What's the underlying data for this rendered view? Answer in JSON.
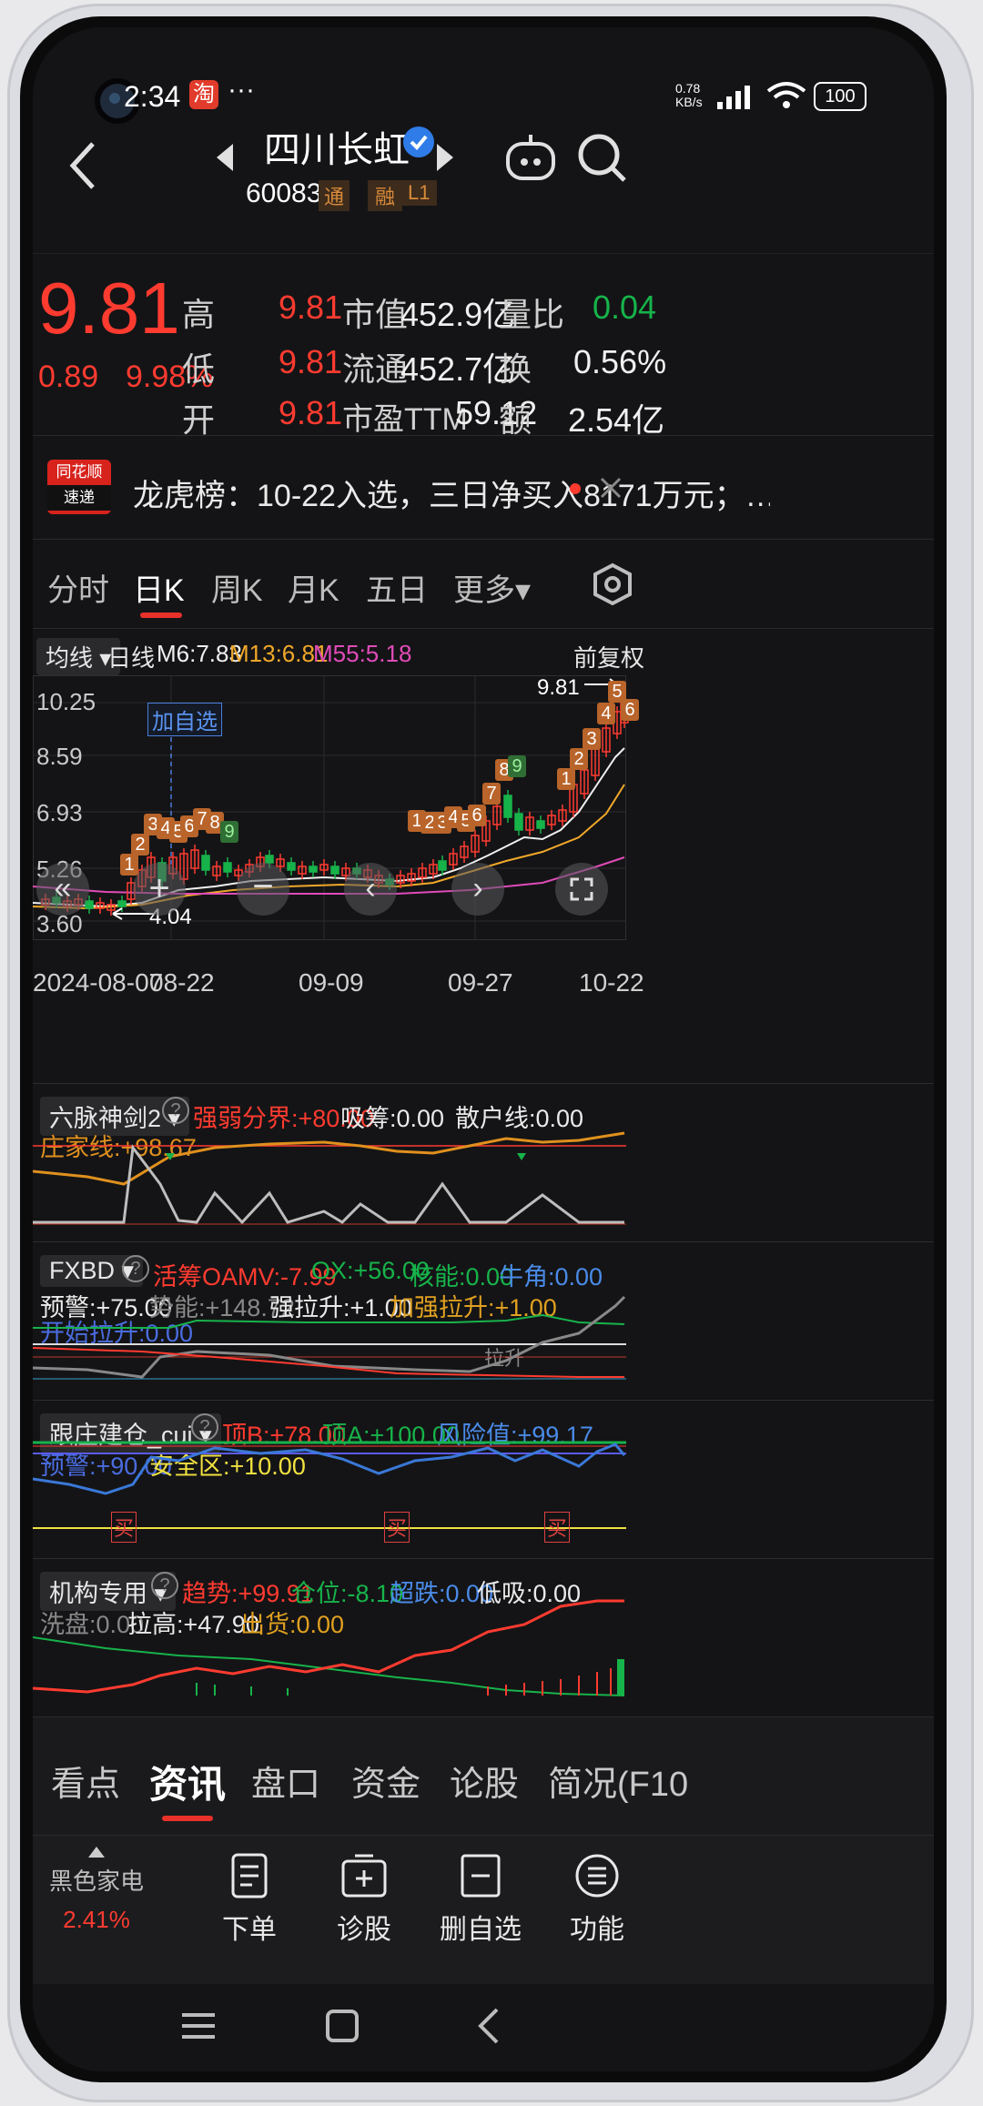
{
  "status": {
    "time": "2:34",
    "app_badge": "淘",
    "dots": "···",
    "net_speed": "0.78 KB/s",
    "battery": "100"
  },
  "stock": {
    "name": "四川长虹",
    "code": "600839",
    "tag1": "通",
    "tag2": "融",
    "tag3": "L1"
  },
  "quote": {
    "price": "9.81",
    "change": "0.89",
    "change_pct": "9.98%",
    "high_label": "高",
    "high": "9.81",
    "low_label": "低",
    "low": "9.81",
    "open_label": "开",
    "open": "9.81",
    "mcap_label": "市值",
    "mcap": "452.9亿",
    "float_label": "流通",
    "float": "452.7亿",
    "pe_label": "市盈TTM",
    "pe": "59.12",
    "vr_label": "量比",
    "vr": "0.04",
    "turn_label": "换",
    "turn": "0.56%",
    "amt_label": "额",
    "amt": "2.54亿"
  },
  "news": {
    "logo_top": "同花顺",
    "logo_bottom": "速递",
    "text": "龙虎榜：10-22入选，三日净买入8171万元；…"
  },
  "period_tabs": [
    "分时",
    "日K",
    "周K",
    "月K",
    "五日",
    "更多▾"
  ],
  "legend": {
    "ma_button": "均线",
    "daily": "日线",
    "m6": "M6:7.83",
    "m13": "M13:6.81",
    "m55": "M55:5.18",
    "adjust": "前复权"
  },
  "main_chart": {
    "y_ticks": [
      "10.25",
      "8.59",
      "6.93",
      "5.26",
      "3.60"
    ],
    "x_ticks": [
      "2024-08-07",
      "08-22",
      "09-09",
      "09-27",
      "10-22"
    ],
    "add_watch": "加自选",
    "max_label": "9.81",
    "min_label": "4.04",
    "counters": [
      "1",
      "2",
      "3",
      "4",
      "5",
      "6",
      "7",
      "8",
      "9",
      "1",
      "2",
      "3",
      "4",
      "5",
      "6",
      "7",
      "8",
      "9",
      "1",
      "2",
      "3",
      "4",
      "5",
      "6"
    ]
  },
  "ind1": {
    "name": "六脉神剑2",
    "strong_weak": "强弱分界:+80.00",
    "absorb": "吸筹:0.00",
    "retail": "散户线:0.00",
    "dealer": "庄家线:+98.67"
  },
  "ind2": {
    "name": "FXBD",
    "active": "活筹OAMV:-7.99",
    "ox": "OX:+56.00",
    "core": "核能:0.00",
    "horn": "牛角:0.00",
    "warn": "预警:+75.00",
    "energy": "势能:+148.72",
    "pull": "强拉升:+1.00",
    "pull2": "加强拉升:+1.00",
    "start": "开始拉升:0.00",
    "lift": "拉升"
  },
  "ind3": {
    "name": "跟庄建仓_cui",
    "topb": "顶B:+78.00",
    "topa": "顶A:+100.00",
    "risk": "风险值:+99.17",
    "warn": "预警:+90.00",
    "safe": "安全区:+10.00",
    "buy": "买"
  },
  "ind4": {
    "name": "机构专用",
    "trend": "趋势:+99.91",
    "position": "仓位:-8.10",
    "oversold": "超跌:0.00",
    "low_buy": "低吸:0.00",
    "wash": "洗盘:0.00",
    "raise": "拉高:+47.90",
    "ship": "出货:0.00"
  },
  "bottom_tabs": [
    "看点",
    "资讯",
    "盘口",
    "资金",
    "论股",
    "简况(F10"
  ],
  "actions": {
    "sector": "黑色家电",
    "sector_pct": "2.41%",
    "order": "下单",
    "diagnose": "诊股",
    "remove_watch": "删自选",
    "function": "功能"
  }
}
